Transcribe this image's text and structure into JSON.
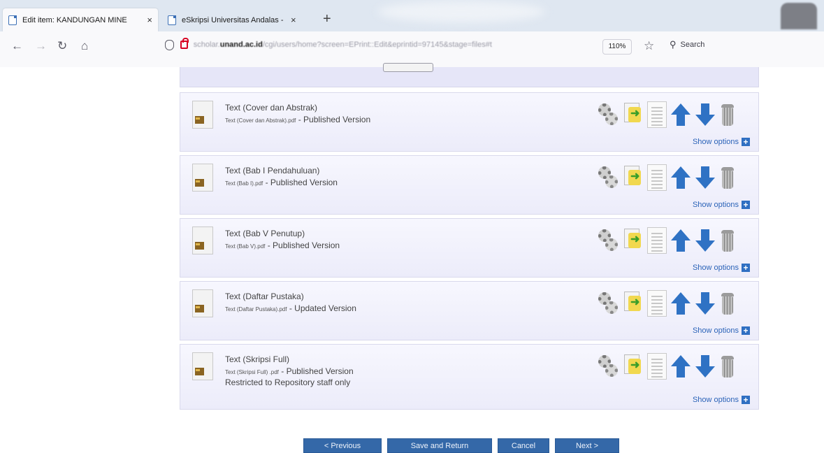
{
  "browser": {
    "tabs": [
      {
        "title": "Edit item: KANDUNGAN MINE",
        "active": true
      },
      {
        "title": "eSkripsi Universitas Andalas - ",
        "active": false
      }
    ],
    "new_tab": "+",
    "url_domain": "scholar.unand.ac.id",
    "url_prefix": "scholar.",
    "url_bold": "unand.ac.id",
    "url_rest": "/cgi/users/home?screen=EPrint::Edit&eprintid=97145&stage=files#t",
    "zoom": "110%",
    "search_placeholder": "Search"
  },
  "files": [
    {
      "title": "Text (Cover dan Abstrak)",
      "filename": "Text (Cover dan Abstrak).pdf",
      "version": " - Published Version",
      "extra": ""
    },
    {
      "title": "Text (Bab I Pendahuluan)",
      "filename": "Text (Bab I).pdf",
      "version": " - Published Version",
      "extra": ""
    },
    {
      "title": "Text (Bab V Penutup)",
      "filename": "Text (Bab V).pdf",
      "version": " - Published Version",
      "extra": ""
    },
    {
      "title": "Text (Daftar Pustaka)",
      "filename": "Text (Daftar Pustaka).pdf",
      "version": " - Updated Version",
      "extra": ""
    },
    {
      "title": "Text (Skripsi Full)",
      "filename": "Text (Skripsi Full) .pdf",
      "version": " - Published Version",
      "extra": "Restricted to Repository staff only"
    }
  ],
  "show_options_label": "Show options",
  "wizard": {
    "previous": "< Previous",
    "save_return": "Save and Return",
    "cancel": "Cancel",
    "next": "Next >"
  },
  "colors": {
    "panel_bg": "#ececfa",
    "link": "#2b63b8",
    "button": "#3468a8",
    "arrow": "#2f72c4"
  }
}
